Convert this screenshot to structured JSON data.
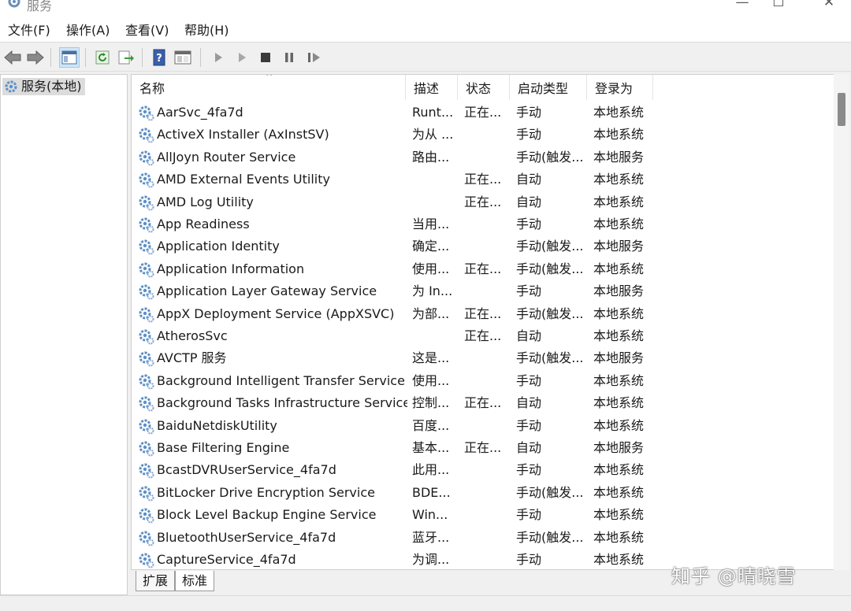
{
  "window": {
    "title": "服务",
    "controls": [
      "—",
      "☐",
      "✕"
    ]
  },
  "menu": [
    {
      "label": "文件(F)"
    },
    {
      "label": "操作(A)"
    },
    {
      "label": "查看(V)"
    },
    {
      "label": "帮助(H)"
    }
  ],
  "toolbar": {
    "buttons": [
      "back-arrow-icon",
      "forward-arrow-icon",
      "show-hide-console-tree-icon",
      "refresh-icon",
      "export-list-icon",
      "help-icon",
      "properties-icon",
      "start-service-icon",
      "start-service-alt-icon",
      "stop-service-icon",
      "pause-service-icon",
      "restart-service-icon"
    ]
  },
  "tree": {
    "root": "服务(本地)"
  },
  "columns": {
    "name": "名称",
    "desc": "描述",
    "status": "状态",
    "startup": "启动类型",
    "logon": "登录为"
  },
  "services": [
    {
      "name": "AarSvc_4fa7d",
      "desc": "Runt...",
      "status": "正在...",
      "startup": "手动",
      "logon": "本地系统"
    },
    {
      "name": "ActiveX Installer (AxInstSV)",
      "desc": "为从 ...",
      "status": "",
      "startup": "手动",
      "logon": "本地系统"
    },
    {
      "name": "AllJoyn Router Service",
      "desc": "路由...",
      "status": "",
      "startup": "手动(触发...",
      "logon": "本地服务"
    },
    {
      "name": "AMD External Events Utility",
      "desc": "",
      "status": "正在...",
      "startup": "自动",
      "logon": "本地系统"
    },
    {
      "name": "AMD Log Utility",
      "desc": "",
      "status": "正在...",
      "startup": "自动",
      "logon": "本地系统"
    },
    {
      "name": "App Readiness",
      "desc": "当用...",
      "status": "",
      "startup": "手动",
      "logon": "本地系统"
    },
    {
      "name": "Application Identity",
      "desc": "确定...",
      "status": "",
      "startup": "手动(触发...",
      "logon": "本地服务"
    },
    {
      "name": "Application Information",
      "desc": "使用...",
      "status": "正在...",
      "startup": "手动(触发...",
      "logon": "本地系统"
    },
    {
      "name": "Application Layer Gateway Service",
      "desc": "为 In...",
      "status": "",
      "startup": "手动",
      "logon": "本地服务"
    },
    {
      "name": "AppX Deployment Service (AppXSVC)",
      "desc": "为部...",
      "status": "正在...",
      "startup": "手动(触发...",
      "logon": "本地系统"
    },
    {
      "name": "AtherosSvc",
      "desc": "",
      "status": "正在...",
      "startup": "自动",
      "logon": "本地系统"
    },
    {
      "name": "AVCTP 服务",
      "desc": "这是...",
      "status": "",
      "startup": "手动(触发...",
      "logon": "本地服务"
    },
    {
      "name": "Background Intelligent Transfer Service",
      "desc": "使用...",
      "status": "",
      "startup": "手动",
      "logon": "本地系统"
    },
    {
      "name": "Background Tasks Infrastructure Service",
      "desc": "控制...",
      "status": "正在...",
      "startup": "自动",
      "logon": "本地系统"
    },
    {
      "name": "BaiduNetdiskUtility",
      "desc": "百度...",
      "status": "",
      "startup": "手动",
      "logon": "本地系统"
    },
    {
      "name": "Base Filtering Engine",
      "desc": "基本...",
      "status": "正在...",
      "startup": "自动",
      "logon": "本地服务"
    },
    {
      "name": "BcastDVRUserService_4fa7d",
      "desc": "此用...",
      "status": "",
      "startup": "手动",
      "logon": "本地系统"
    },
    {
      "name": "BitLocker Drive Encryption Service",
      "desc": "BDE...",
      "status": "",
      "startup": "手动(触发...",
      "logon": "本地系统"
    },
    {
      "name": "Block Level Backup Engine Service",
      "desc": "Win...",
      "status": "",
      "startup": "手动",
      "logon": "本地系统"
    },
    {
      "name": "BluetoothUserService_4fa7d",
      "desc": "蓝牙...",
      "status": "",
      "startup": "手动(触发...",
      "logon": "本地系统"
    },
    {
      "name": "CaptureService_4fa7d",
      "desc": "为调...",
      "status": "",
      "startup": "手动",
      "logon": "本地系统"
    }
  ],
  "tabs": [
    {
      "label": "扩展",
      "selected": false
    },
    {
      "label": "标准",
      "selected": true
    }
  ],
  "watermark": "知乎 @晴晓雪",
  "colors": {
    "selection": "#dcdcdc",
    "toolbar_active": "#cfe6f7",
    "gear_blue": "#5b8fc7"
  }
}
